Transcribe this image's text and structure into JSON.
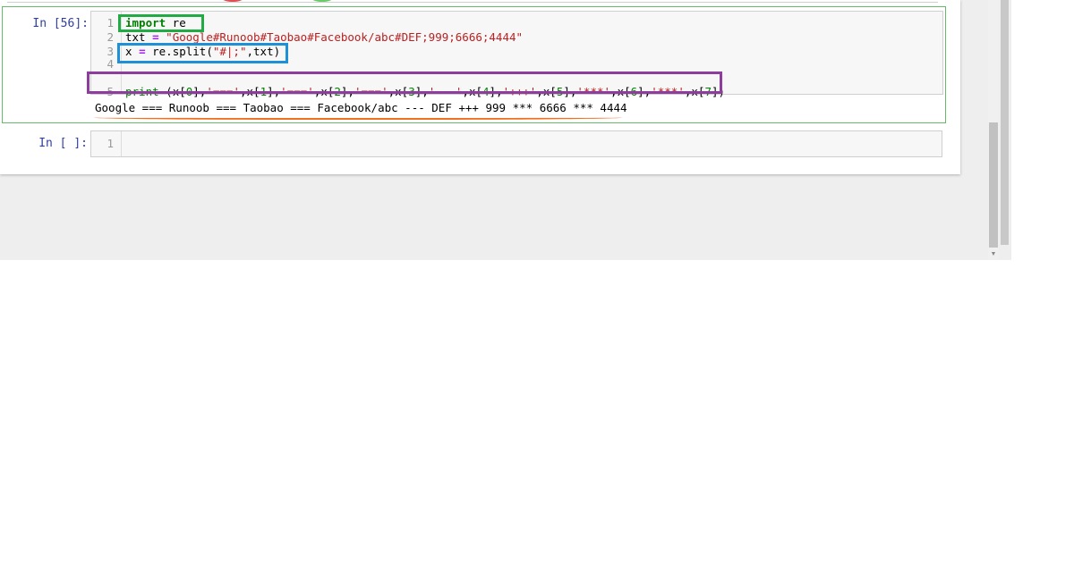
{
  "cells": [
    {
      "prompt": "In [56]:",
      "lines": [
        {
          "n": "1",
          "tokens": [
            {
              "t": "import",
              "c": "kw"
            },
            {
              "t": " re",
              "c": ""
            }
          ]
        },
        {
          "n": "2",
          "tokens": [
            {
              "t": "txt ",
              "c": ""
            },
            {
              "t": "=",
              "c": "op"
            },
            {
              "t": " ",
              "c": ""
            },
            {
              "t": "\"Google#Runoob#Taobao#Facebook/abc#DEF;999;6666;4444\"",
              "c": "str"
            }
          ]
        },
        {
          "n": "3",
          "tokens": [
            {
              "t": "x ",
              "c": ""
            },
            {
              "t": "=",
              "c": "op"
            },
            {
              "t": " re.split(",
              "c": ""
            },
            {
              "t": "\"#|;\"",
              "c": "str"
            },
            {
              "t": ",txt)",
              "c": ""
            }
          ]
        },
        {
          "n": "4",
          "tokens": []
        },
        {
          "n": "5",
          "tokens": [
            {
              "t": "print",
              "c": "bi"
            },
            {
              "t": " (x[",
              "c": ""
            },
            {
              "t": "0",
              "c": "num"
            },
            {
              "t": "],",
              "c": ""
            },
            {
              "t": "'==='",
              "c": "str"
            },
            {
              "t": ",x[",
              "c": ""
            },
            {
              "t": "1",
              "c": "num"
            },
            {
              "t": "],",
              "c": ""
            },
            {
              "t": "'==='",
              "c": "str"
            },
            {
              "t": ",x[",
              "c": ""
            },
            {
              "t": "2",
              "c": "num"
            },
            {
              "t": "],",
              "c": ""
            },
            {
              "t": "'==='",
              "c": "str"
            },
            {
              "t": ",x[",
              "c": ""
            },
            {
              "t": "3",
              "c": "num"
            },
            {
              "t": "],",
              "c": ""
            },
            {
              "t": "'---'",
              "c": "str"
            },
            {
              "t": ",x[",
              "c": ""
            },
            {
              "t": "4",
              "c": "num"
            },
            {
              "t": "],",
              "c": ""
            },
            {
              "t": "'+++'",
              "c": "str"
            },
            {
              "t": ",x[",
              "c": ""
            },
            {
              "t": "5",
              "c": "num"
            },
            {
              "t": "],",
              "c": ""
            },
            {
              "t": "'***'",
              "c": "str"
            },
            {
              "t": ",x[",
              "c": ""
            },
            {
              "t": "6",
              "c": "num"
            },
            {
              "t": "],",
              "c": ""
            },
            {
              "t": "'***'",
              "c": "str"
            },
            {
              "t": ",x[",
              "c": ""
            },
            {
              "t": "7",
              "c": "num"
            },
            {
              "t": "])",
              "c": ""
            }
          ]
        }
      ],
      "output": "Google === Runoob === Taobao === Facebook/abc --- DEF +++ 999 *** 6666 *** 4444"
    },
    {
      "prompt": "In [ ]:",
      "lines": [
        {
          "n": "1",
          "tokens": []
        }
      ]
    }
  ],
  "colors": {
    "cell_selected_border": "#66bb6a",
    "prompt": "#303f9f",
    "annotation_green": "#22aa44",
    "annotation_blue": "#1e90d8",
    "annotation_purple": "#8e3c9e",
    "annotation_orange": "#f07020"
  }
}
